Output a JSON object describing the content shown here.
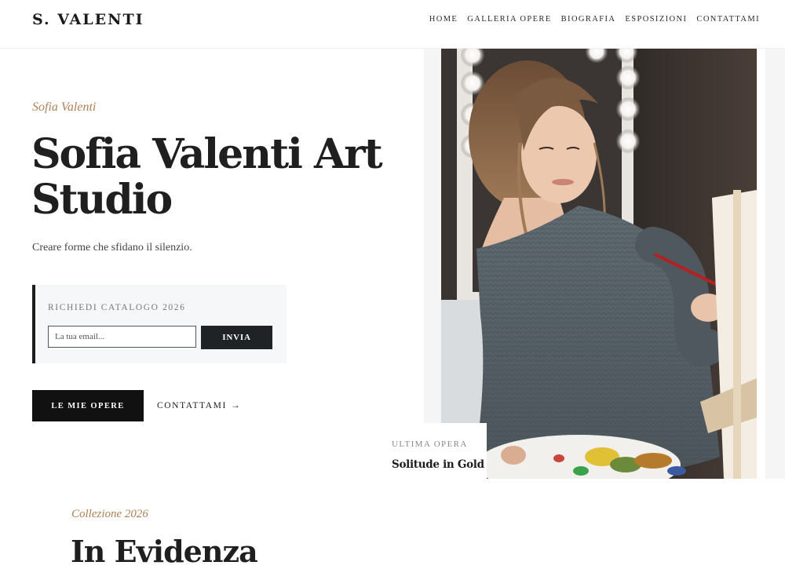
{
  "header": {
    "logo": "S. VALENTI",
    "nav": [
      "HOME",
      "GALLERIA OPERE",
      "BIOGRAFIA",
      "ESPOSIZIONI",
      "CONTATTAMI"
    ]
  },
  "hero": {
    "eyebrow": "Sofia Valenti",
    "title": "Sofia Valenti Art Studio",
    "subtitle": "Creare forme che sfidano il silenzio.",
    "catalog": {
      "label": "RICHIEDI CATALOGO 2026",
      "input_placeholder": "La tua email...",
      "submit_label": "INVIA"
    },
    "primary_button": "LE MIE OPERE",
    "secondary_link": "CONTATTAMI",
    "secondary_arrow": "→"
  },
  "latest": {
    "label": "ULTIMA OPERA",
    "title": "Solitude in Gold"
  },
  "collection": {
    "eyebrow": "Collezione 2026",
    "title": "In Evidenza"
  },
  "colors": {
    "accent": "#b08055",
    "dark": "#111111",
    "panel": "#f6f7f8"
  },
  "icons": {
    "arrow": "arrow-right-icon",
    "photo": "artist-painting-photo"
  }
}
